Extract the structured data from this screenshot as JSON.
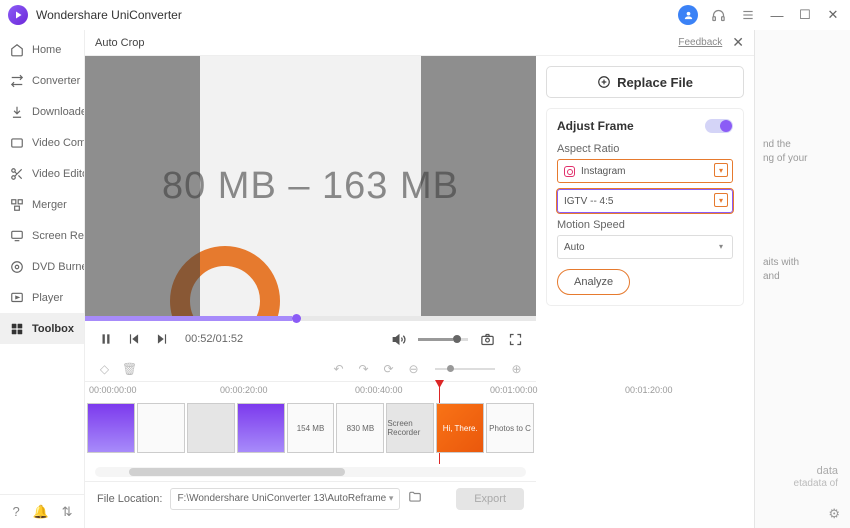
{
  "app": {
    "title": "Wondershare UniConverter"
  },
  "window_controls": {
    "min": "—",
    "max": "☐",
    "close": "✕"
  },
  "sidebar": {
    "items": [
      {
        "label": "Home",
        "icon": "home"
      },
      {
        "label": "Converter",
        "icon": "convert"
      },
      {
        "label": "Downloader",
        "icon": "download"
      },
      {
        "label": "Video Compressor",
        "icon": "compress"
      },
      {
        "label": "Video Editor",
        "icon": "scissors"
      },
      {
        "label": "Merger",
        "icon": "merge"
      },
      {
        "label": "Screen Recorder",
        "icon": "screen"
      },
      {
        "label": "DVD Burner",
        "icon": "dvd"
      },
      {
        "label": "Player",
        "icon": "player"
      },
      {
        "label": "Toolbox",
        "icon": "toolbox",
        "active": true
      }
    ]
  },
  "autocrop": {
    "title": "Auto Crop",
    "feedback": "Feedback",
    "replace": "Replace File",
    "adjust_frame": "Adjust Frame",
    "aspect_ratio_label": "Aspect Ratio",
    "platform": "Instagram",
    "ratio": "IGTV -- 4:5",
    "motion_label": "Motion Speed",
    "motion_value": "Auto",
    "analyze": "Analyze"
  },
  "video": {
    "overlay_text": "80 MB   –   163 MB",
    "timecode": "00:52/01:52"
  },
  "timeline": {
    "ticks": [
      "00:00:00:00",
      "00:00:20:00",
      "00:00:40:00",
      "00:01:00:00",
      "00:01:20:00"
    ],
    "thumbs": [
      {
        "label": "",
        "cls": "purple"
      },
      {
        "label": "",
        "cls": "white"
      },
      {
        "label": "",
        "cls": "grey"
      },
      {
        "label": "",
        "cls": "purple"
      },
      {
        "label": "154 MB",
        "cls": "white"
      },
      {
        "label": "830 MB",
        "cls": "white"
      },
      {
        "label": "Screen Recorder",
        "cls": "grey"
      },
      {
        "label": "Hi, There.",
        "cls": "orange"
      },
      {
        "label": "Photos to C",
        "cls": "white"
      }
    ]
  },
  "file": {
    "label": "File Location:",
    "path": "F:\\Wondershare UniConverter 13\\AutoReframe",
    "export": "Export"
  },
  "bg": {
    "line1": "nd the",
    "line2": "ng of your",
    "line3": "aits with",
    "line4": "and",
    "meta1": "data",
    "meta2": "etadata of"
  }
}
